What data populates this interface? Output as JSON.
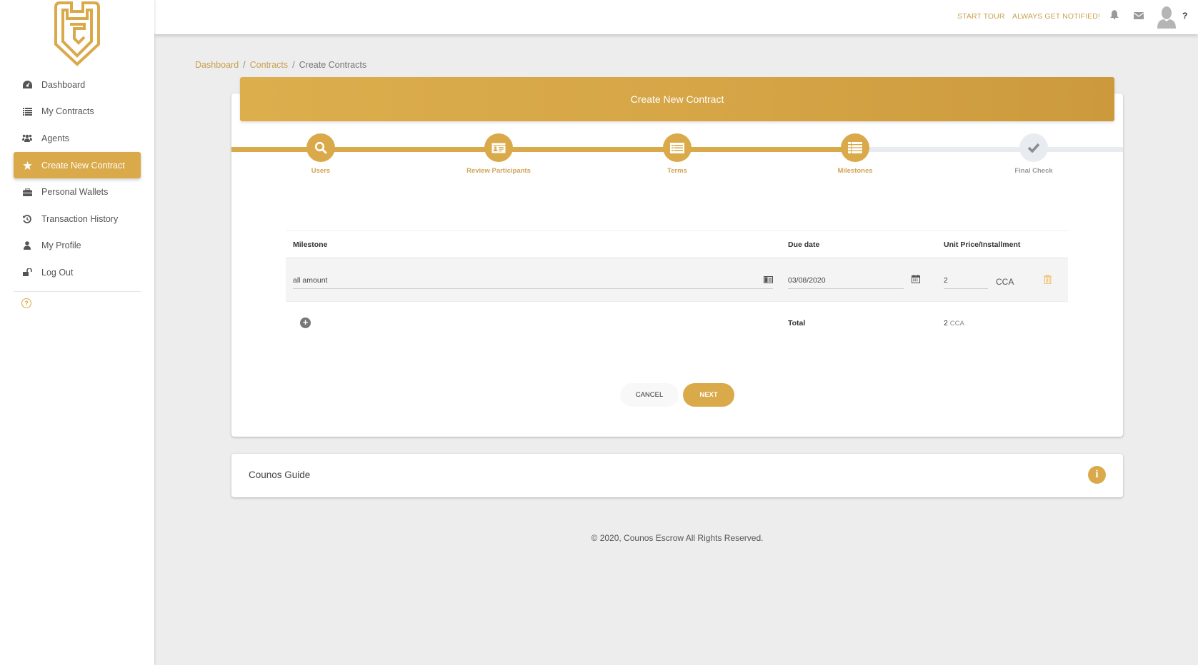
{
  "app": {
    "brand": "Counos Escrow",
    "accent_color": "#d9a94a"
  },
  "sidebar": {
    "items": [
      {
        "label": "Dashboard",
        "icon": "dashboard-icon",
        "active": false
      },
      {
        "label": "My Contracts",
        "icon": "list-icon",
        "active": false
      },
      {
        "label": "Agents",
        "icon": "users-icon",
        "active": false
      },
      {
        "label": "Create New Contract",
        "icon": "star-icon",
        "active": true
      },
      {
        "label": "Personal Wallets",
        "icon": "briefcase-icon",
        "active": false
      },
      {
        "label": "Transaction History",
        "icon": "history-icon",
        "active": false
      },
      {
        "label": "My Profile",
        "icon": "user-icon",
        "active": false
      },
      {
        "label": "Log Out",
        "icon": "unlock-icon",
        "active": false
      }
    ],
    "help_icon": "question-circle-icon"
  },
  "topbar": {
    "start_tour": "START TOUR",
    "notify": "ALWAYS GET NOTIFIED!",
    "help": "?"
  },
  "breadcrumb": {
    "items": [
      "Dashboard",
      "Contracts",
      "Create Contracts"
    ],
    "separator": "/"
  },
  "wizard": {
    "title": "Create New Contract",
    "steps": [
      {
        "label": "Users",
        "icon": "search-icon",
        "state": "done"
      },
      {
        "label": "Review Participants",
        "icon": "id-card-icon",
        "state": "done"
      },
      {
        "label": "Terms",
        "icon": "list-alt-icon",
        "state": "done"
      },
      {
        "label": "Milestones",
        "icon": "list-icon",
        "state": "current"
      },
      {
        "label": "Final Check",
        "icon": "check-icon",
        "state": "todo"
      }
    ]
  },
  "milestones": {
    "columns": [
      "Milestone",
      "Due date",
      "Unit Price/Installment"
    ],
    "rows": [
      {
        "milestone": "all amount",
        "due_date": "03/08/2020",
        "price": "2",
        "currency": "CCA"
      }
    ],
    "total_label": "Total",
    "total_value": "2",
    "total_currency": "CCA"
  },
  "buttons": {
    "cancel": "CANCEL",
    "next": "NEXT"
  },
  "guide": {
    "title": "Counos Guide",
    "icon": "info-icon"
  },
  "footer": {
    "text": "© 2020, Counos Escrow All Rights Reserved."
  }
}
